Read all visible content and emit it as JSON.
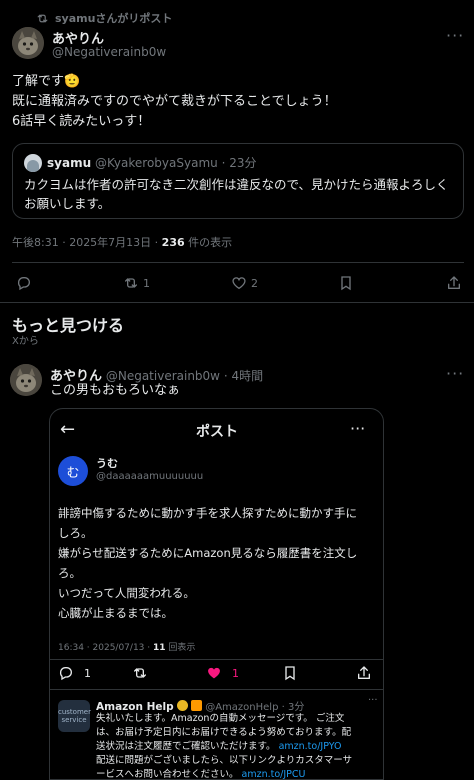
{
  "repost": {
    "label": "syamuさんがリポスト"
  },
  "main_post": {
    "display_name": "あやりん",
    "handle": "@Negativerainb0w",
    "lines": [
      "了解です🫡",
      "既に通報済みですのでやがて裁きが下ることでしょう！",
      "6話早く読みたいっす！"
    ],
    "quote": {
      "display_name": "syamu",
      "handle": "@KyakerobyaSyamu",
      "time": "· 23分",
      "text": "カクヨムは作者の許可なき二次創作は違反なので、見かけたら通報よろしくお願いします。"
    },
    "meta": {
      "timestamp": "午後8:31 · 2025年7月13日 · ",
      "views_count": "236",
      "views_label": " 件の表示"
    },
    "actions": {
      "retweets": "1",
      "likes": "2"
    }
  },
  "more_section": {
    "title": "もっと見つける",
    "subtitle": "Xから"
  },
  "second_post": {
    "display_name": "あやりん",
    "handle": "@Negativerainb0w",
    "time": "· 4時間",
    "text": "この男もおもろいなぁ"
  },
  "embedded": {
    "header_title": "ポスト",
    "author_avatar_letter": "む",
    "author_name": "うむ",
    "author_handle": "@daaaaaamuuuuuuu",
    "lines": [
      "誹謗中傷するために動かす手を求人探すために動かす手に",
      "しろ。",
      "嫌がらせ配送するためにAmazon見るなら履歴書を注文し",
      "ろ。",
      "いつだって人間変われる。",
      "心臓が止まるまでは。"
    ],
    "meta_prefix": "16:34 · 2025/07/13 · ",
    "views_count": "11",
    "views_label": " 回表示",
    "replies": "1",
    "likes": "1",
    "reply": {
      "avatar_text": "customer service",
      "name": "Amazon Help",
      "handle": "@AmazonHelp · 3分",
      "line1": "失礼いたします。Amazonの自動メッセージです。 ご注文",
      "line2": "は、お届け予定日内にお届けできるよう努めております。配",
      "line3_text": "送状況は注文履歴でご確認いただけます。 ",
      "line3_link": "amzn.to/JPYO",
      "line4": "配送に問題がございましたら、以下リンクよりカスタマーサ",
      "line5_text": "ービスへお問い合わせください。 ",
      "line5_link": "amzn.to/JPCU"
    }
  }
}
